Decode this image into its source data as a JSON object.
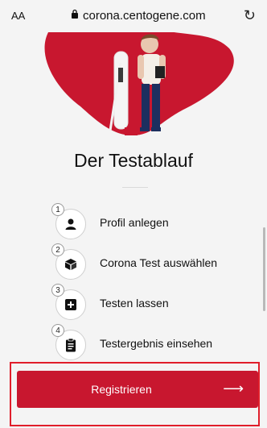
{
  "browser": {
    "text_size_label": "AA",
    "url": "corona.centogene.com",
    "icons": {
      "lock": "lock-icon",
      "reload": "reload-icon"
    }
  },
  "page": {
    "title": "Der Testablauf",
    "steps": [
      {
        "number": "1",
        "label": "Profil anlegen",
        "icon": "person-icon"
      },
      {
        "number": "2",
        "label": "Corona Test auswählen",
        "icon": "box-icon"
      },
      {
        "number": "3",
        "label": "Testen lassen",
        "icon": "plus-square-icon"
      },
      {
        "number": "4",
        "label": "Testergebnis einsehen",
        "icon": "clipboard-icon"
      }
    ]
  },
  "cta": {
    "label": "Registrieren",
    "icon": "arrow-right-icon"
  },
  "colors": {
    "brand_red": "#c8172f",
    "highlight_red": "#e01e2b"
  }
}
